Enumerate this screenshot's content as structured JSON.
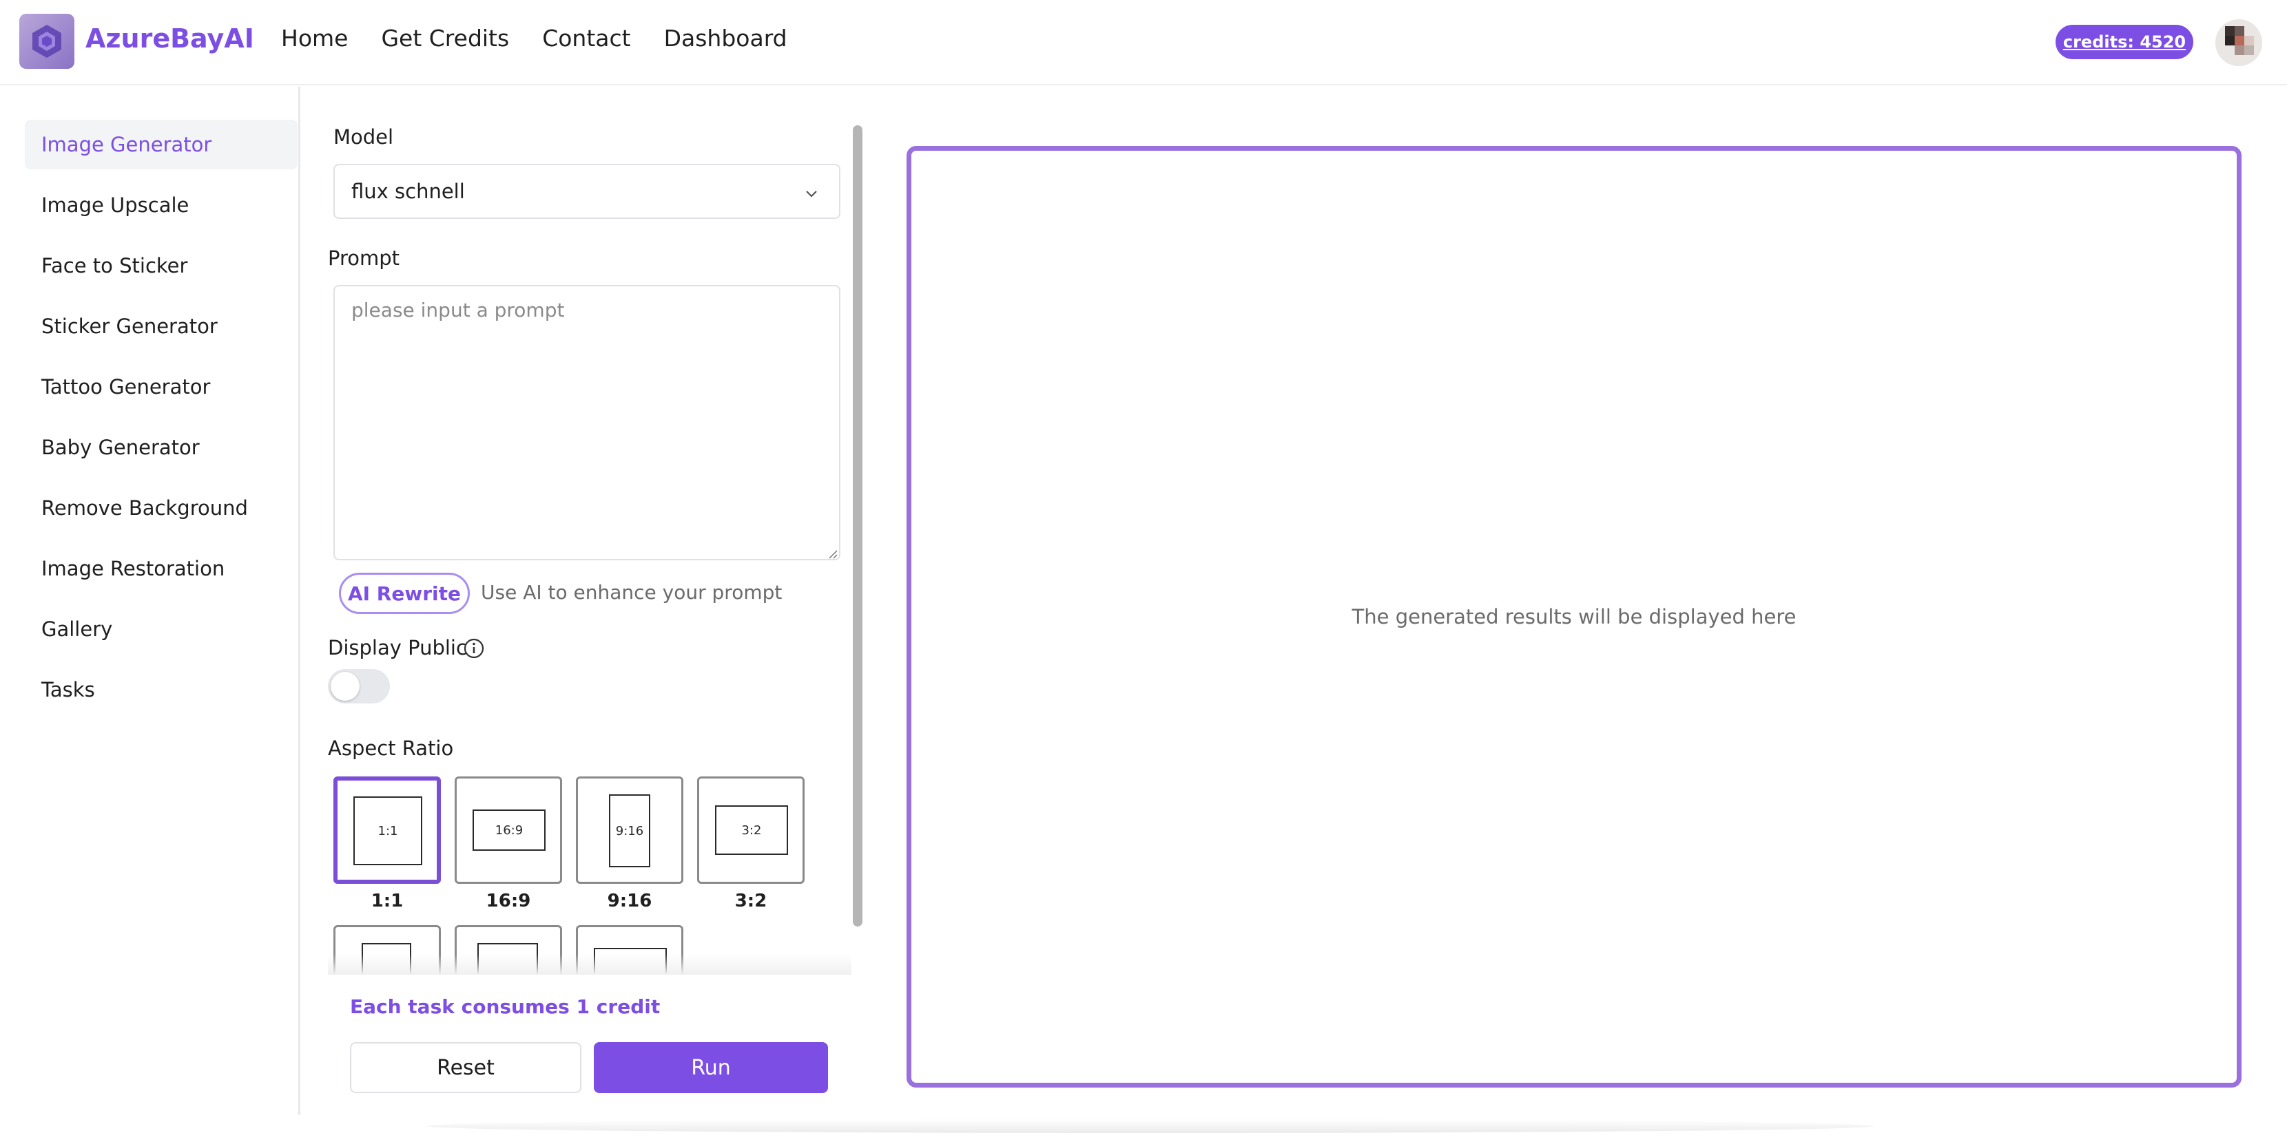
{
  "header": {
    "brand": "AzureBayAI",
    "nav": [
      "Home",
      "Get Credits",
      "Contact",
      "Dashboard"
    ],
    "credits": "credits: 4520",
    "accent": "#7c4ee4"
  },
  "sidebar": {
    "items": [
      {
        "label": "Image Generator",
        "active": true
      },
      {
        "label": "Image Upscale"
      },
      {
        "label": "Face to Sticker"
      },
      {
        "label": "Sticker Generator"
      },
      {
        "label": "Tattoo Generator"
      },
      {
        "label": "Baby Generator"
      },
      {
        "label": "Remove Background"
      },
      {
        "label": "Image Restoration"
      },
      {
        "label": "Gallery"
      },
      {
        "label": "Tasks"
      }
    ]
  },
  "form": {
    "model_label": "Model",
    "model_value": "flux schnell",
    "prompt_label": "Prompt",
    "prompt_placeholder": "please input a prompt",
    "rewrite_label": "AI Rewrite",
    "rewrite_hint": "Use AI to enhance your prompt",
    "display_public_label": "Display Public",
    "display_public_on": false,
    "aspect_ratio_label": "Aspect Ratio",
    "aspect_ratios": [
      {
        "label": "1:1",
        "selected": true
      },
      {
        "label": "16:9"
      },
      {
        "label": "9:16"
      },
      {
        "label": "3:2"
      }
    ],
    "consume_text": "Each task consumes 1 credit",
    "reset_label": "Reset",
    "run_label": "Run"
  },
  "result": {
    "placeholder": "The generated results will be displayed here"
  }
}
